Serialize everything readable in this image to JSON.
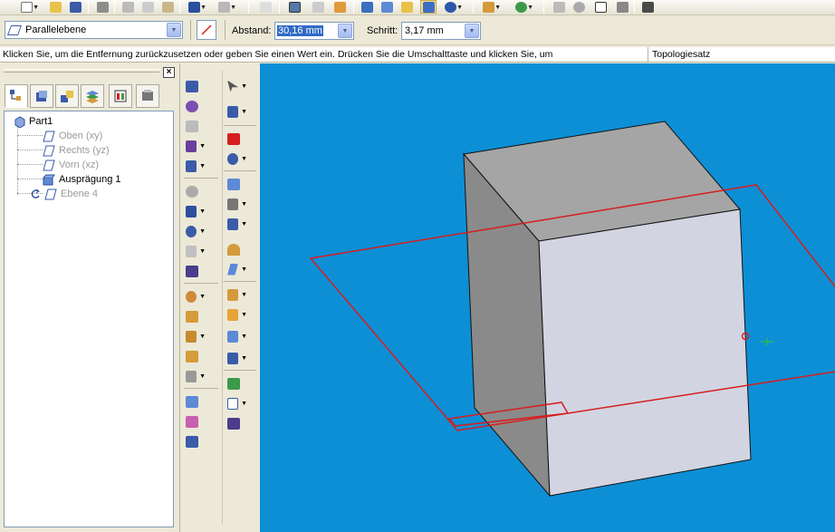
{
  "toolbar": {
    "icons": [
      "new-icon",
      "open-icon",
      "save-icon",
      "print-icon",
      "cut-icon",
      "copy-icon",
      "paste-icon",
      "undo-icon",
      "redo-icon",
      "close-window-icon",
      "window-icon",
      "tile-icon",
      "palette-icon",
      "view-iso-icon",
      "view-top-icon",
      "view-front-icon",
      "shaded-icon",
      "render-icon",
      "layers-icon",
      "settings-icon",
      "zoom-area-icon",
      "zoom-icon",
      "fit-icon",
      "pan-icon",
      "help-icon"
    ]
  },
  "ribbon": {
    "plane_select": "Parallelebene",
    "distance_label": "Abstand:",
    "distance_value": "30,16 mm",
    "step_label": "Schritt:",
    "step_value": "3,17 mm"
  },
  "prompt": {
    "message": "Klicken Sie, um die Entfernung zurückzusetzen oder geben Sie einen Wert ein. Drücken Sie die Umschalttaste und klicken Sie, um",
    "right": "Topologiesatz"
  },
  "pane": {
    "close": "×",
    "tree": [
      {
        "label": "Part1",
        "dim": false
      },
      {
        "label": "Oben (xy)",
        "dim": true
      },
      {
        "label": "Rechts (yz)",
        "dim": true
      },
      {
        "label": "Vorn (xz)",
        "dim": true
      },
      {
        "label": "Ausprägung 1",
        "dim": false
      },
      {
        "label": "Ebene 4",
        "dim": true
      }
    ]
  },
  "colors": {
    "viewport_bg": "#0d8fd6",
    "plane_outline": "#d61e1e",
    "box_front": "#d2d4e2",
    "box_top": "#a5a5a5",
    "box_side": "#8a8a8a"
  }
}
